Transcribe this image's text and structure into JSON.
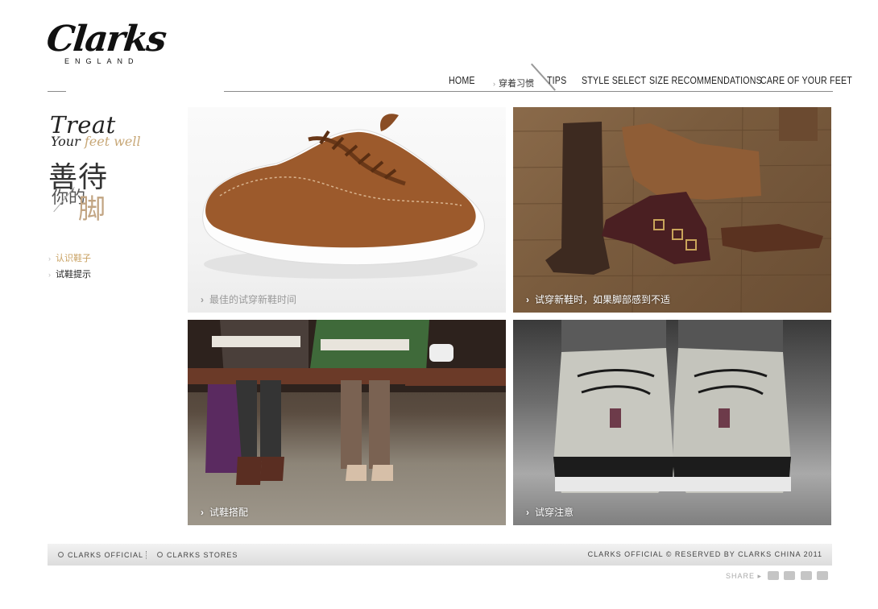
{
  "logo": {
    "word": "Clarks",
    "sub": "ENGLAND"
  },
  "nav": {
    "home": "HOME",
    "habits": "穿着习惯",
    "tips": "TIPS",
    "style": "STYLE SELECT",
    "size": "SIZE RECOMMENDATIONS",
    "care": "CARE OF YOUR FEET"
  },
  "slogan": {
    "treat": "Treat",
    "your": "Your",
    "feet_well": "feet well",
    "cn_line1": "善待",
    "cn_line2": "你的",
    "cn_line3": "脚"
  },
  "side_menu": [
    {
      "label": "认识鞋子",
      "active": true
    },
    {
      "label": "试鞋提示",
      "active": false
    }
  ],
  "tiles": [
    {
      "caption": "最佳的试穿新鞋时间"
    },
    {
      "caption": "试穿新鞋时，如果脚部感到不适"
    },
    {
      "caption": "试鞋搭配"
    },
    {
      "caption": "试穿注意"
    }
  ],
  "footer": {
    "official": "CLARKS OFFICIAL",
    "stores": "CLARKS STORES",
    "copyright": "CLARKS  OFFICIAL  ©  RESERVED BY CLARKS CHINA 2011"
  },
  "share": {
    "label": "SHARE ▸"
  },
  "colors": {
    "accent_gold": "#c8a060",
    "nav_line": "#8a8a8a"
  }
}
